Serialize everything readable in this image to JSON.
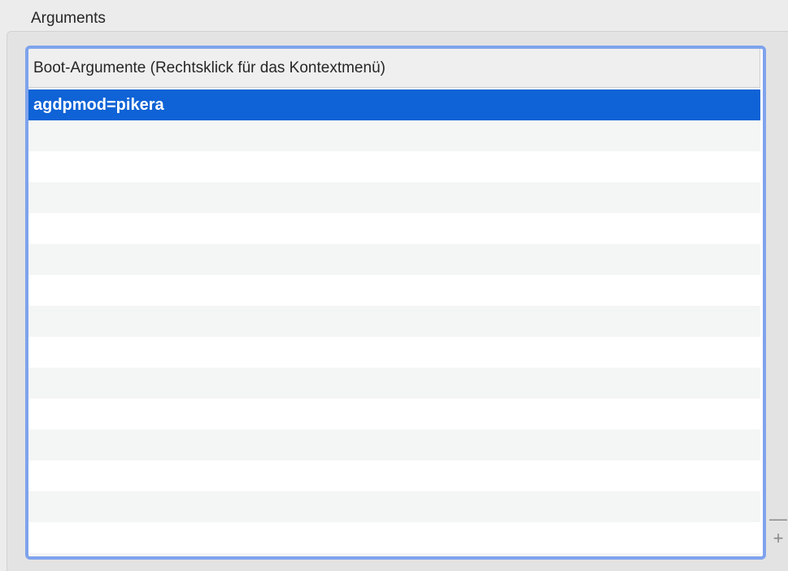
{
  "section": {
    "label": "Arguments"
  },
  "table": {
    "column_header": "Boot-Argumente (Rechtsklick für das Kontextmenü)",
    "rows": [
      {
        "value": "agdpmod=pikera",
        "selected": true
      },
      {
        "value": ""
      },
      {
        "value": ""
      },
      {
        "value": ""
      },
      {
        "value": ""
      },
      {
        "value": ""
      },
      {
        "value": ""
      },
      {
        "value": ""
      },
      {
        "value": ""
      },
      {
        "value": ""
      },
      {
        "value": ""
      },
      {
        "value": ""
      },
      {
        "value": ""
      },
      {
        "value": ""
      },
      {
        "value": ""
      },
      {
        "value": ""
      }
    ]
  },
  "controls": {
    "remove_label": "—",
    "add_label": "+"
  },
  "colors": {
    "focus_ring": "#7fa3ec",
    "selection": "#0f63d6"
  }
}
